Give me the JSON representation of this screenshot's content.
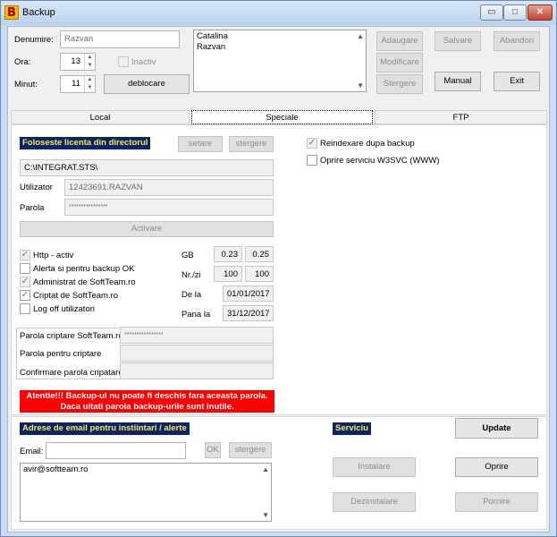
{
  "window": {
    "title": "Backup",
    "app_icon_letter": "B"
  },
  "titlebar": {
    "minimize": "▭",
    "maximize": "□",
    "close": "✕"
  },
  "top": {
    "denumire_label": "Denumire:",
    "denumire_value": "Razvan",
    "ora_label": "Ora:",
    "ora_value": "13",
    "minut_label": "Minut:",
    "minut_value": "11",
    "inactiv_label": "Inactiv",
    "deblocare_button": "deblocare",
    "list_items": [
      "Catalina",
      "Razvan"
    ],
    "adaugare": "Adaugare",
    "salvare": "Salvare",
    "abandon": "Abandon",
    "modificare": "Modificare",
    "stergere": "Stergere",
    "manual": "Manual",
    "exit": "Exit"
  },
  "tabs": [
    {
      "label": "Local"
    },
    {
      "label": "Speciale"
    },
    {
      "label": "FTP"
    }
  ],
  "licenta": {
    "header": "Foloseste licenta din directorul",
    "setare": "setare",
    "stergere": "stergere",
    "path": "C:\\INTEGRAT.STS\\",
    "utilizator_label": "Utilizator",
    "utilizator_value": "12423691.RAZVAN",
    "parola_label": "Parola",
    "parola_value": "****************",
    "activare": "Activare"
  },
  "options": {
    "http": "Http - activ",
    "alerta": "Alerta si pentru backup OK",
    "administrat": "Administrat de SoftTeam.ro",
    "criptat": "Criptat de SoftTeam.ro",
    "logoff": "Log off utilizatori"
  },
  "stats": {
    "gb_label": "GB",
    "gb_1": "0.23",
    "gb_2": "0.25",
    "nrzi_label": "Nr./zi",
    "nrzi_1": "100",
    "nrzi_2": "100",
    "dela_label": "De la",
    "dela_value": "01/01/2017",
    "panala_label": "Pana la",
    "panala_value": "31/12/2017"
  },
  "right_options": {
    "reindexare": "Reindexare dupa backup",
    "oprire_w3svc": "Oprire serviciu W3SVC (WWW)"
  },
  "cripto": {
    "parola_softteam_label": "Parola criptare SoftTeam.ro",
    "parola_softteam_value": "****************",
    "parola_criptare_label": "Parola pentru criptare",
    "confirmare_label": "Confirmare parola cripatare"
  },
  "warning": {
    "line1": "Atentie!!! Backup-ul nu poate fi deschis fara aceasta parola.",
    "line2": "Daca uitati parola backup-urile sunt inutile."
  },
  "email": {
    "header": "Adrese de email pentru instiintari / alerte",
    "email_label": "Email:",
    "ok": "OK",
    "stergere": "stergere",
    "list_items": [
      "avir@softteam.ro"
    ]
  },
  "serviciu": {
    "header": "Serviciu",
    "update": "Update",
    "instalare": "Instalare",
    "oprire": "Oprire",
    "dezinstalare": "Dezinstalare",
    "pornire": "Pornire"
  }
}
